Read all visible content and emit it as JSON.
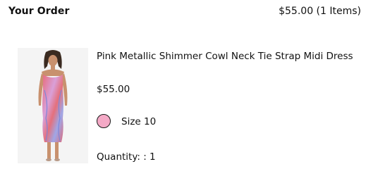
{
  "header": {
    "title": "Your Order",
    "summary": "$55.00 (1 Items)"
  },
  "item": {
    "name": "Pink Metallic Shimmer Cowl Neck Tie Strap Midi Dress",
    "price": "$55.00",
    "color_swatch_hex": "#f4a9c6",
    "size": "Size 10",
    "quantity": "Quantity: : 1",
    "image_icon": "product-photo"
  }
}
